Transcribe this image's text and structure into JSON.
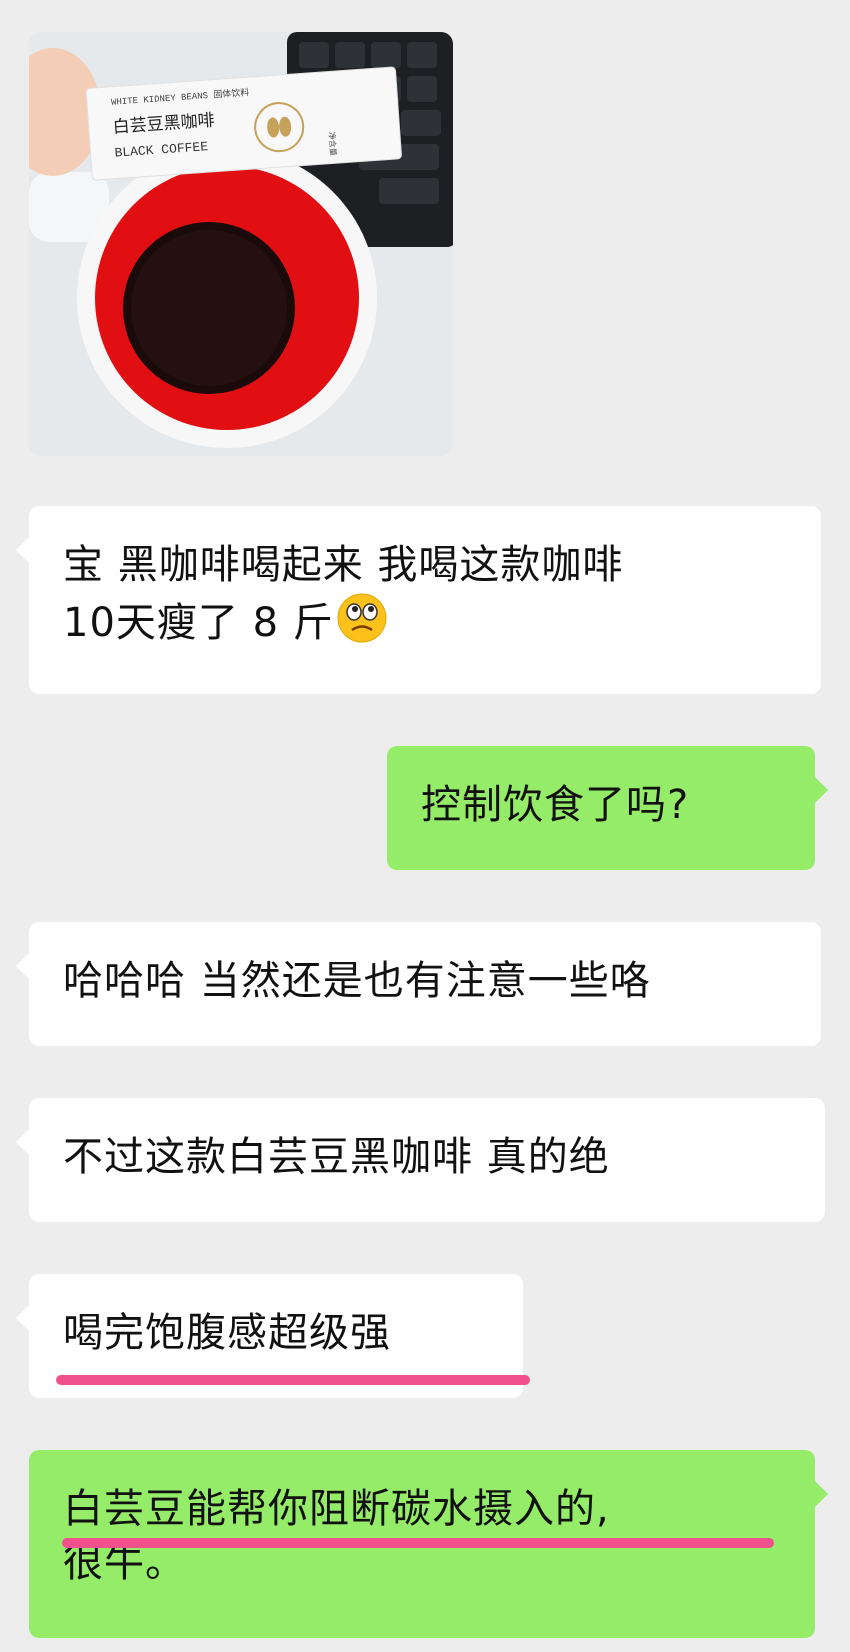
{
  "colors": {
    "background": "#ededed",
    "incoming_bubble": "#ffffff",
    "outgoing_bubble": "#95ec69",
    "highlight_mark": "#f0508c"
  },
  "photo": {
    "packet_line1": "WHITE KIDNEY BEANS 固体饮料",
    "packet_line2": "白芸豆黑咖啡",
    "packet_line3": "BLACK COFFEE",
    "packet_side": "净含量"
  },
  "messages": [
    {
      "side": "in",
      "text_line1": "宝  黑咖啡喝起来  我喝这款咖啡",
      "text_line2": "10天瘦了 8 斤",
      "emoji": "confused-face-icon"
    },
    {
      "side": "out",
      "text": "控制饮食了吗?"
    },
    {
      "side": "in",
      "text": "哈哈哈 当然还是也有注意一些咯"
    },
    {
      "side": "in",
      "text": "不过这款白芸豆黑咖啡 真的绝"
    },
    {
      "side": "in",
      "text": "喝完饱腹感超级强"
    },
    {
      "side": "out",
      "text_line1": "白芸豆能帮你阻断碳水摄入的,",
      "text_line2": "很牛。"
    }
  ]
}
